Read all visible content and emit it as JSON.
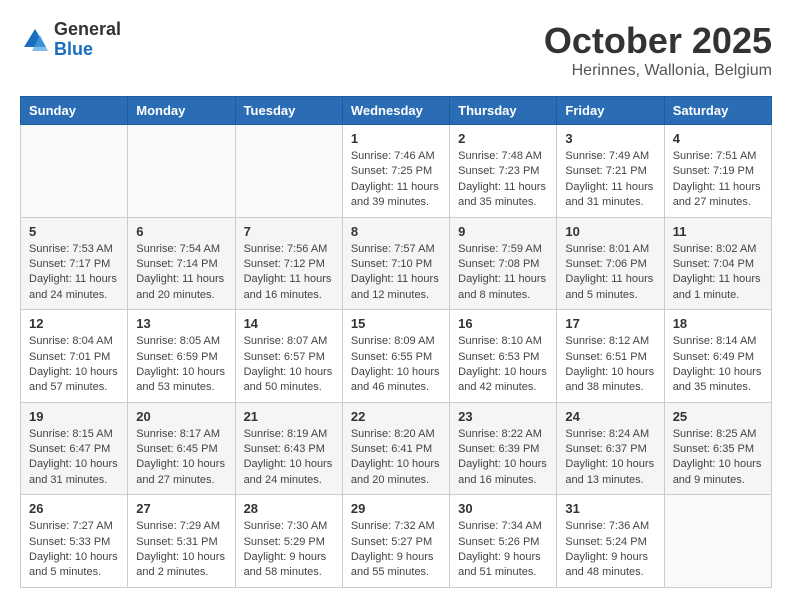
{
  "header": {
    "logo": {
      "general": "General",
      "blue": "Blue"
    },
    "title": "October 2025",
    "subtitle": "Herinnes, Wallonia, Belgium"
  },
  "calendar": {
    "weekdays": [
      "Sunday",
      "Monday",
      "Tuesday",
      "Wednesday",
      "Thursday",
      "Friday",
      "Saturday"
    ],
    "weeks": [
      [
        {
          "day": "",
          "info": ""
        },
        {
          "day": "",
          "info": ""
        },
        {
          "day": "",
          "info": ""
        },
        {
          "day": "1",
          "info": "Sunrise: 7:46 AM\nSunset: 7:25 PM\nDaylight: 11 hours\nand 39 minutes."
        },
        {
          "day": "2",
          "info": "Sunrise: 7:48 AM\nSunset: 7:23 PM\nDaylight: 11 hours\nand 35 minutes."
        },
        {
          "day": "3",
          "info": "Sunrise: 7:49 AM\nSunset: 7:21 PM\nDaylight: 11 hours\nand 31 minutes."
        },
        {
          "day": "4",
          "info": "Sunrise: 7:51 AM\nSunset: 7:19 PM\nDaylight: 11 hours\nand 27 minutes."
        }
      ],
      [
        {
          "day": "5",
          "info": "Sunrise: 7:53 AM\nSunset: 7:17 PM\nDaylight: 11 hours\nand 24 minutes."
        },
        {
          "day": "6",
          "info": "Sunrise: 7:54 AM\nSunset: 7:14 PM\nDaylight: 11 hours\nand 20 minutes."
        },
        {
          "day": "7",
          "info": "Sunrise: 7:56 AM\nSunset: 7:12 PM\nDaylight: 11 hours\nand 16 minutes."
        },
        {
          "day": "8",
          "info": "Sunrise: 7:57 AM\nSunset: 7:10 PM\nDaylight: 11 hours\nand 12 minutes."
        },
        {
          "day": "9",
          "info": "Sunrise: 7:59 AM\nSunset: 7:08 PM\nDaylight: 11 hours\nand 8 minutes."
        },
        {
          "day": "10",
          "info": "Sunrise: 8:01 AM\nSunset: 7:06 PM\nDaylight: 11 hours\nand 5 minutes."
        },
        {
          "day": "11",
          "info": "Sunrise: 8:02 AM\nSunset: 7:04 PM\nDaylight: 11 hours\nand 1 minute."
        }
      ],
      [
        {
          "day": "12",
          "info": "Sunrise: 8:04 AM\nSunset: 7:01 PM\nDaylight: 10 hours\nand 57 minutes."
        },
        {
          "day": "13",
          "info": "Sunrise: 8:05 AM\nSunset: 6:59 PM\nDaylight: 10 hours\nand 53 minutes."
        },
        {
          "day": "14",
          "info": "Sunrise: 8:07 AM\nSunset: 6:57 PM\nDaylight: 10 hours\nand 50 minutes."
        },
        {
          "day": "15",
          "info": "Sunrise: 8:09 AM\nSunset: 6:55 PM\nDaylight: 10 hours\nand 46 minutes."
        },
        {
          "day": "16",
          "info": "Sunrise: 8:10 AM\nSunset: 6:53 PM\nDaylight: 10 hours\nand 42 minutes."
        },
        {
          "day": "17",
          "info": "Sunrise: 8:12 AM\nSunset: 6:51 PM\nDaylight: 10 hours\nand 38 minutes."
        },
        {
          "day": "18",
          "info": "Sunrise: 8:14 AM\nSunset: 6:49 PM\nDaylight: 10 hours\nand 35 minutes."
        }
      ],
      [
        {
          "day": "19",
          "info": "Sunrise: 8:15 AM\nSunset: 6:47 PM\nDaylight: 10 hours\nand 31 minutes."
        },
        {
          "day": "20",
          "info": "Sunrise: 8:17 AM\nSunset: 6:45 PM\nDaylight: 10 hours\nand 27 minutes."
        },
        {
          "day": "21",
          "info": "Sunrise: 8:19 AM\nSunset: 6:43 PM\nDaylight: 10 hours\nand 24 minutes."
        },
        {
          "day": "22",
          "info": "Sunrise: 8:20 AM\nSunset: 6:41 PM\nDaylight: 10 hours\nand 20 minutes."
        },
        {
          "day": "23",
          "info": "Sunrise: 8:22 AM\nSunset: 6:39 PM\nDaylight: 10 hours\nand 16 minutes."
        },
        {
          "day": "24",
          "info": "Sunrise: 8:24 AM\nSunset: 6:37 PM\nDaylight: 10 hours\nand 13 minutes."
        },
        {
          "day": "25",
          "info": "Sunrise: 8:25 AM\nSunset: 6:35 PM\nDaylight: 10 hours\nand 9 minutes."
        }
      ],
      [
        {
          "day": "26",
          "info": "Sunrise: 7:27 AM\nSunset: 5:33 PM\nDaylight: 10 hours\nand 5 minutes."
        },
        {
          "day": "27",
          "info": "Sunrise: 7:29 AM\nSunset: 5:31 PM\nDaylight: 10 hours\nand 2 minutes."
        },
        {
          "day": "28",
          "info": "Sunrise: 7:30 AM\nSunset: 5:29 PM\nDaylight: 9 hours\nand 58 minutes."
        },
        {
          "day": "29",
          "info": "Sunrise: 7:32 AM\nSunset: 5:27 PM\nDaylight: 9 hours\nand 55 minutes."
        },
        {
          "day": "30",
          "info": "Sunrise: 7:34 AM\nSunset: 5:26 PM\nDaylight: 9 hours\nand 51 minutes."
        },
        {
          "day": "31",
          "info": "Sunrise: 7:36 AM\nSunset: 5:24 PM\nDaylight: 9 hours\nand 48 minutes."
        },
        {
          "day": "",
          "info": ""
        }
      ]
    ]
  }
}
